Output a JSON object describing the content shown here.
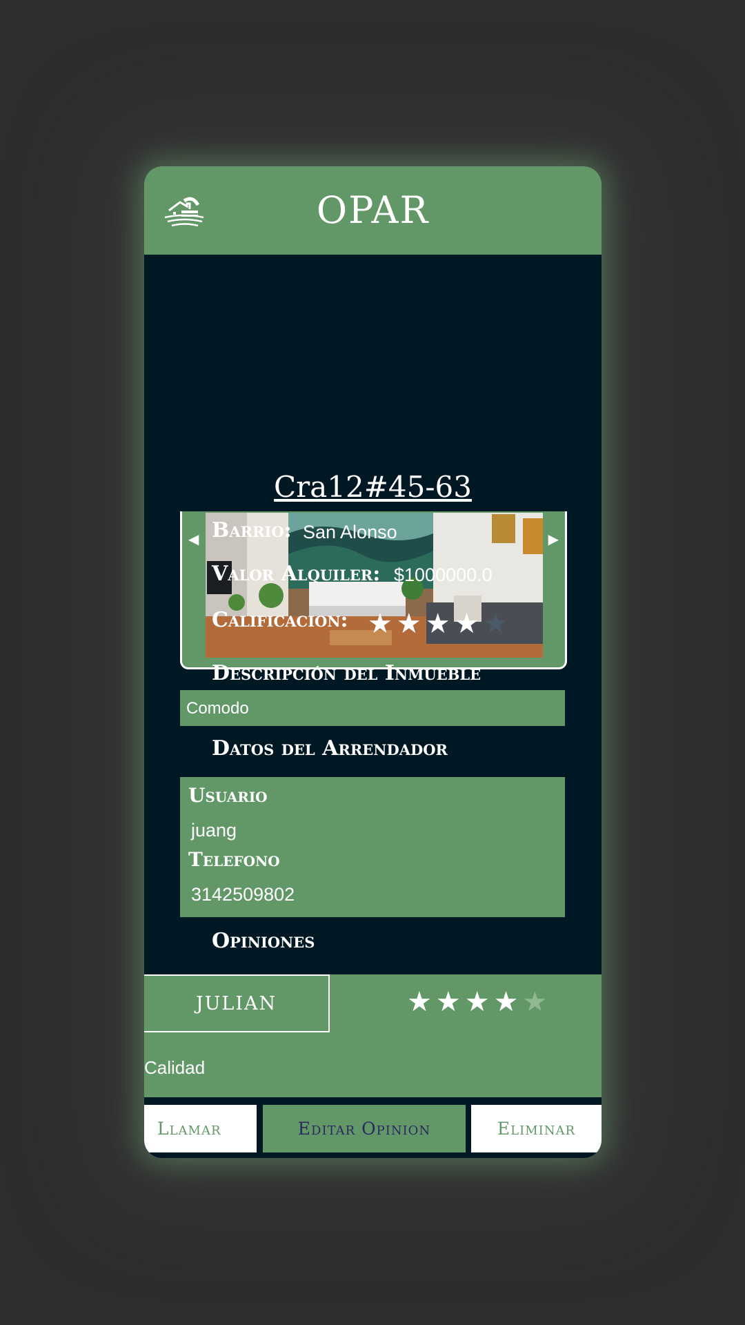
{
  "header": {
    "title": "OPAR"
  },
  "property": {
    "address": "Cra12#45-63",
    "barrio_label": "Barrio:",
    "barrio_value": "San Alonso",
    "rent_label": "Valor Alquiler:",
    "rent_value": "$1000000.0",
    "rating_label": "Calificacion:",
    "rating": 4,
    "rating_max": 5,
    "description_label": "Descripción del Inmueble",
    "description": "Comodo"
  },
  "carousel": {
    "prev_icon": "caret-left-icon",
    "next_icon": "caret-right-icon"
  },
  "owner": {
    "section_label": "Datos del Arrendador",
    "user_label": "Usuario",
    "user_value": "juang",
    "phone_label": "Telefono",
    "phone_value": "3142509802"
  },
  "reviews": {
    "section_label": "Opiniones",
    "items": [
      {
        "user": "JULIAN",
        "rating": 4,
        "rating_max": 5,
        "text": "Calidad"
      }
    ]
  },
  "actions": {
    "call": "Llamar",
    "edit": "Editar Opinion",
    "delete": "Eliminar"
  },
  "colors": {
    "green": "#629867",
    "navy": "#001824",
    "background": "#2e2e2e"
  }
}
